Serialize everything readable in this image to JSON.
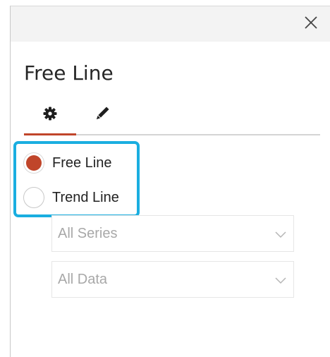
{
  "panel": {
    "title": "Free Line",
    "tabs": [
      {
        "icon": "gear-icon",
        "active": true
      },
      {
        "icon": "pencil-icon",
        "active": false
      }
    ]
  },
  "line_type": {
    "options": [
      {
        "label": "Free Line",
        "checked": true
      },
      {
        "label": "Trend Line",
        "checked": false
      }
    ],
    "accent_color": "#c0452a",
    "highlight_color": "#1aaee0"
  },
  "dropdowns": {
    "series": {
      "value": "All Series",
      "disabled": true
    },
    "data": {
      "value": "All Data",
      "disabled": true
    }
  },
  "icons": {
    "close": "close-icon",
    "chevron": "chevron-down-icon"
  }
}
